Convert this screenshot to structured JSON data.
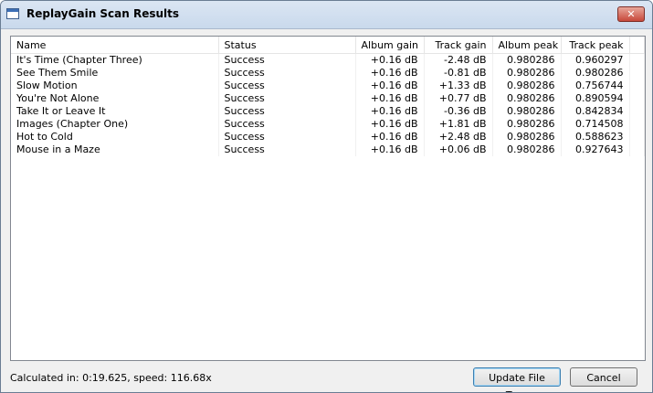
{
  "window": {
    "title": "ReplayGain Scan Results",
    "close_glyph": "✕"
  },
  "columns": [
    "Name",
    "Status",
    "Album gain",
    "Track gain",
    "Album peak",
    "Track peak"
  ],
  "rows": [
    [
      "It's Time (Chapter Three)",
      "Success",
      "+0.16 dB",
      "-2.48 dB",
      "0.980286",
      "0.960297"
    ],
    [
      "See Them Smile",
      "Success",
      "+0.16 dB",
      "-0.81 dB",
      "0.980286",
      "0.980286"
    ],
    [
      "Slow Motion",
      "Success",
      "+0.16 dB",
      "+1.33 dB",
      "0.980286",
      "0.756744"
    ],
    [
      "You're Not Alone",
      "Success",
      "+0.16 dB",
      "+0.77 dB",
      "0.980286",
      "0.890594"
    ],
    [
      "Take It or Leave It",
      "Success",
      "+0.16 dB",
      "-0.36 dB",
      "0.980286",
      "0.842834"
    ],
    [
      "Images (Chapter One)",
      "Success",
      "+0.16 dB",
      "+1.81 dB",
      "0.980286",
      "0.714508"
    ],
    [
      "Hot to Cold",
      "Success",
      "+0.16 dB",
      "+2.48 dB",
      "0.980286",
      "0.588623"
    ],
    [
      "Mouse in a Maze",
      "Success",
      "+0.16 dB",
      "+0.06 dB",
      "0.980286",
      "0.927643"
    ]
  ],
  "footer": {
    "status": "Calculated in: 0:19.625, speed: 116.68x",
    "update_label": "Update File Tags",
    "cancel_label": "Cancel"
  }
}
